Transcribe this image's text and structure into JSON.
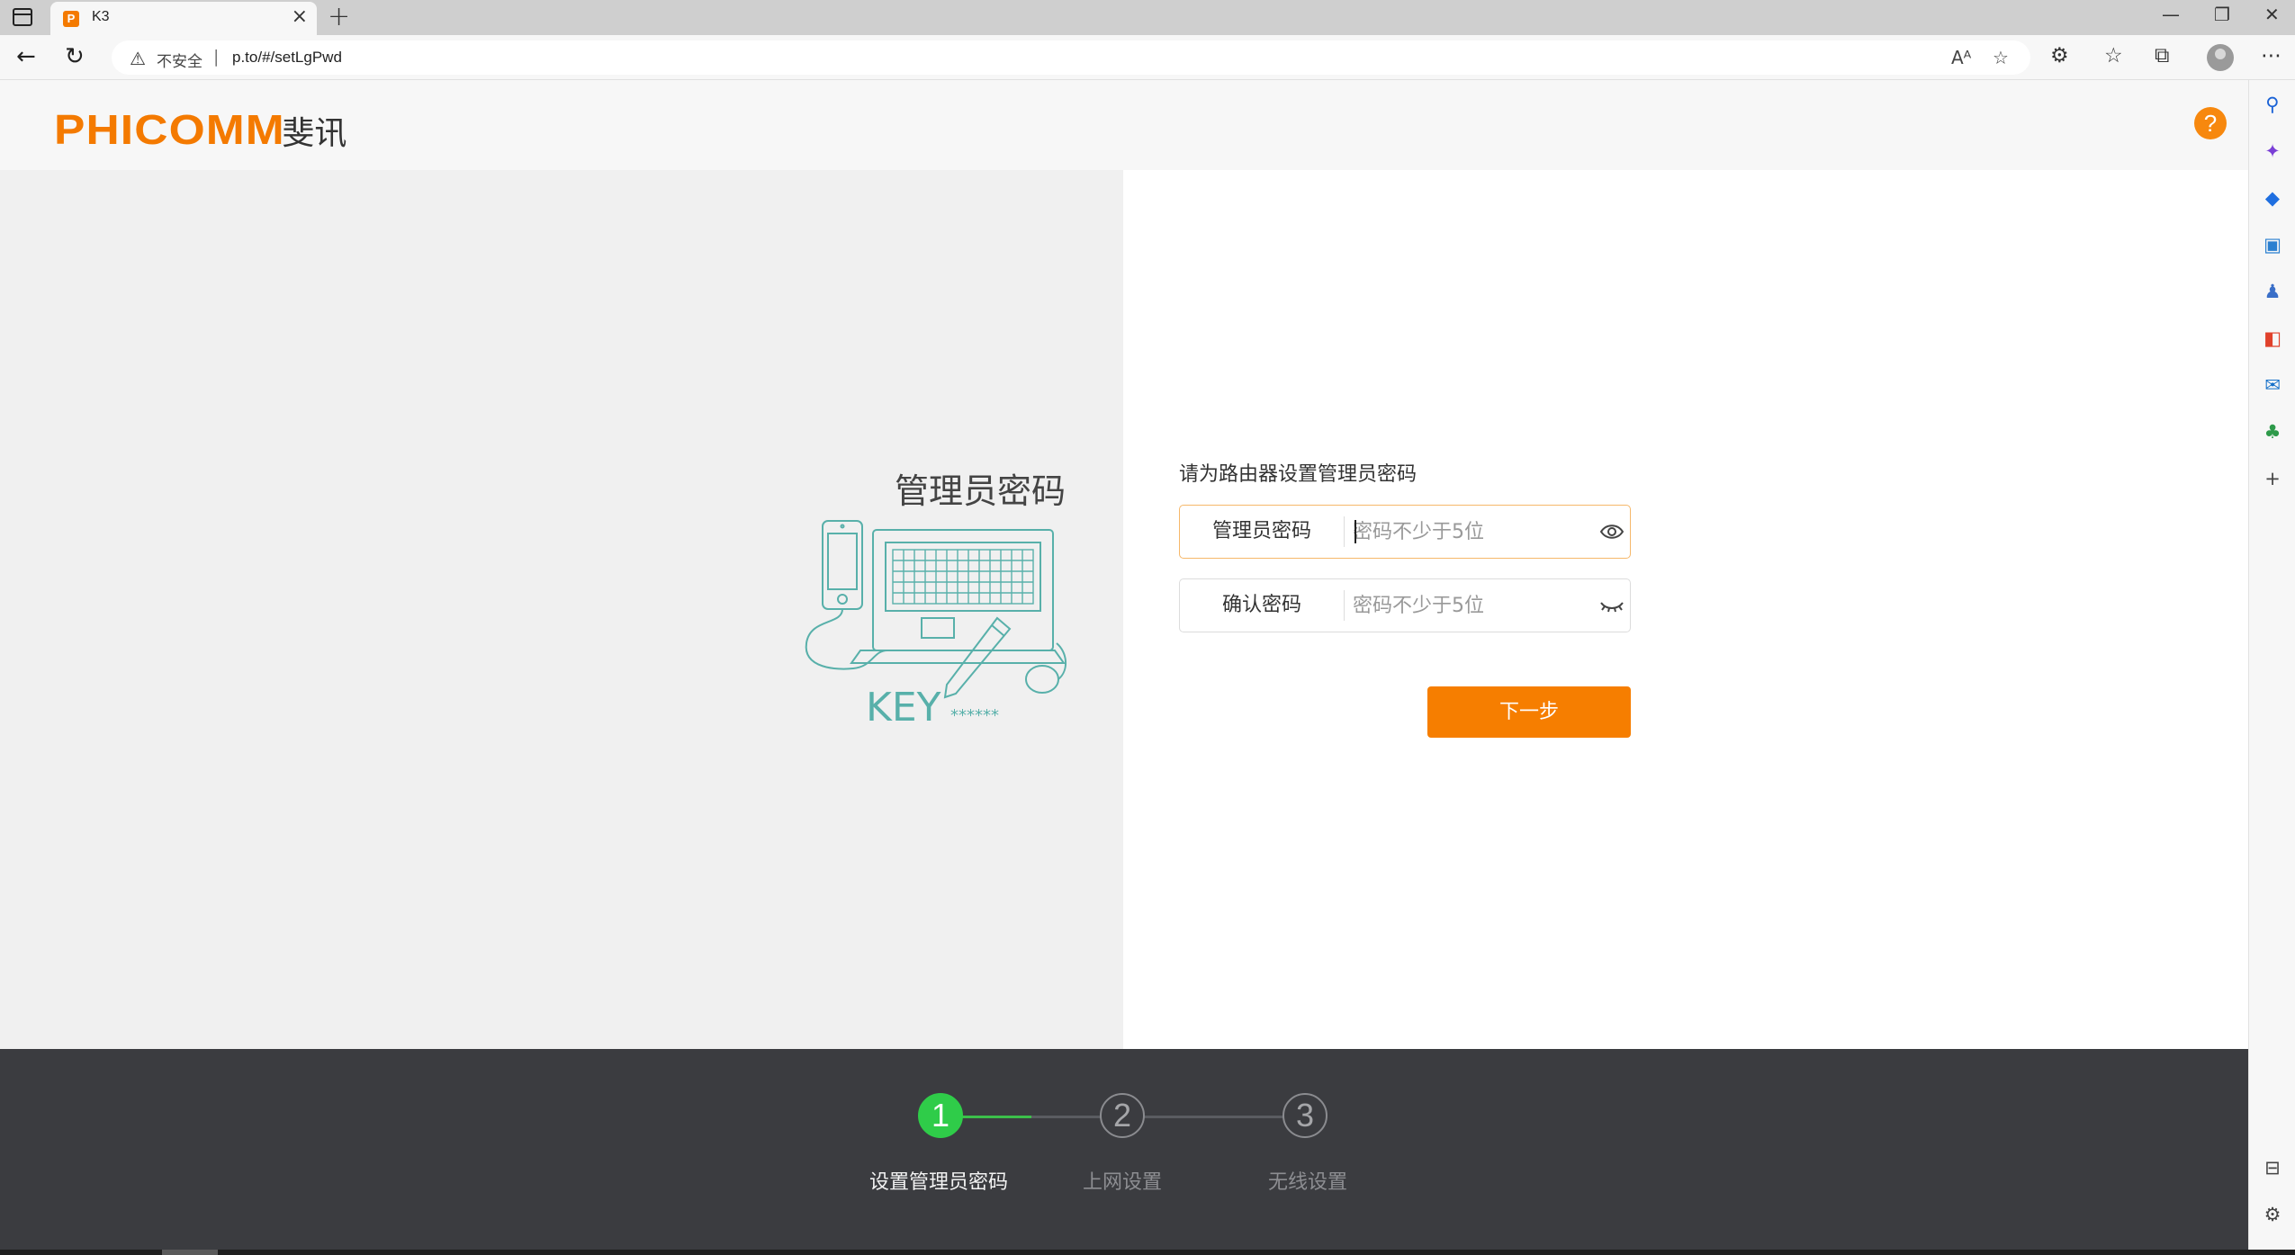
{
  "browser": {
    "tab_title": "K3",
    "tab_favicon_letter": "P",
    "url_security": "不安全",
    "url": "p.to/#/setLgPwd"
  },
  "header": {
    "logo_en": "PHICOMM",
    "logo_cn": "斐讯",
    "help_label": "?"
  },
  "hero": {
    "title": "管理员密码",
    "illustration_key_text": "KEY",
    "illustration_stars": "******"
  },
  "form": {
    "heading": "请为路由器设置管理员密码",
    "admin_password": {
      "label": "管理员密码",
      "placeholder": "密码不少于5位",
      "value": ""
    },
    "confirm_password": {
      "label": "确认密码",
      "placeholder": "密码不少于5位",
      "value": ""
    },
    "next_label": "下一步"
  },
  "steps": [
    {
      "number": "1",
      "label": "设置管理员密码",
      "state": "current"
    },
    {
      "number": "2",
      "label": "上网设置",
      "state": "pending"
    },
    {
      "number": "3",
      "label": "无线设置",
      "state": "pending"
    }
  ],
  "colors": {
    "brand_orange": "#f47a00",
    "step_active_green": "#2fcc49",
    "footer_bg": "#3b3c40"
  }
}
